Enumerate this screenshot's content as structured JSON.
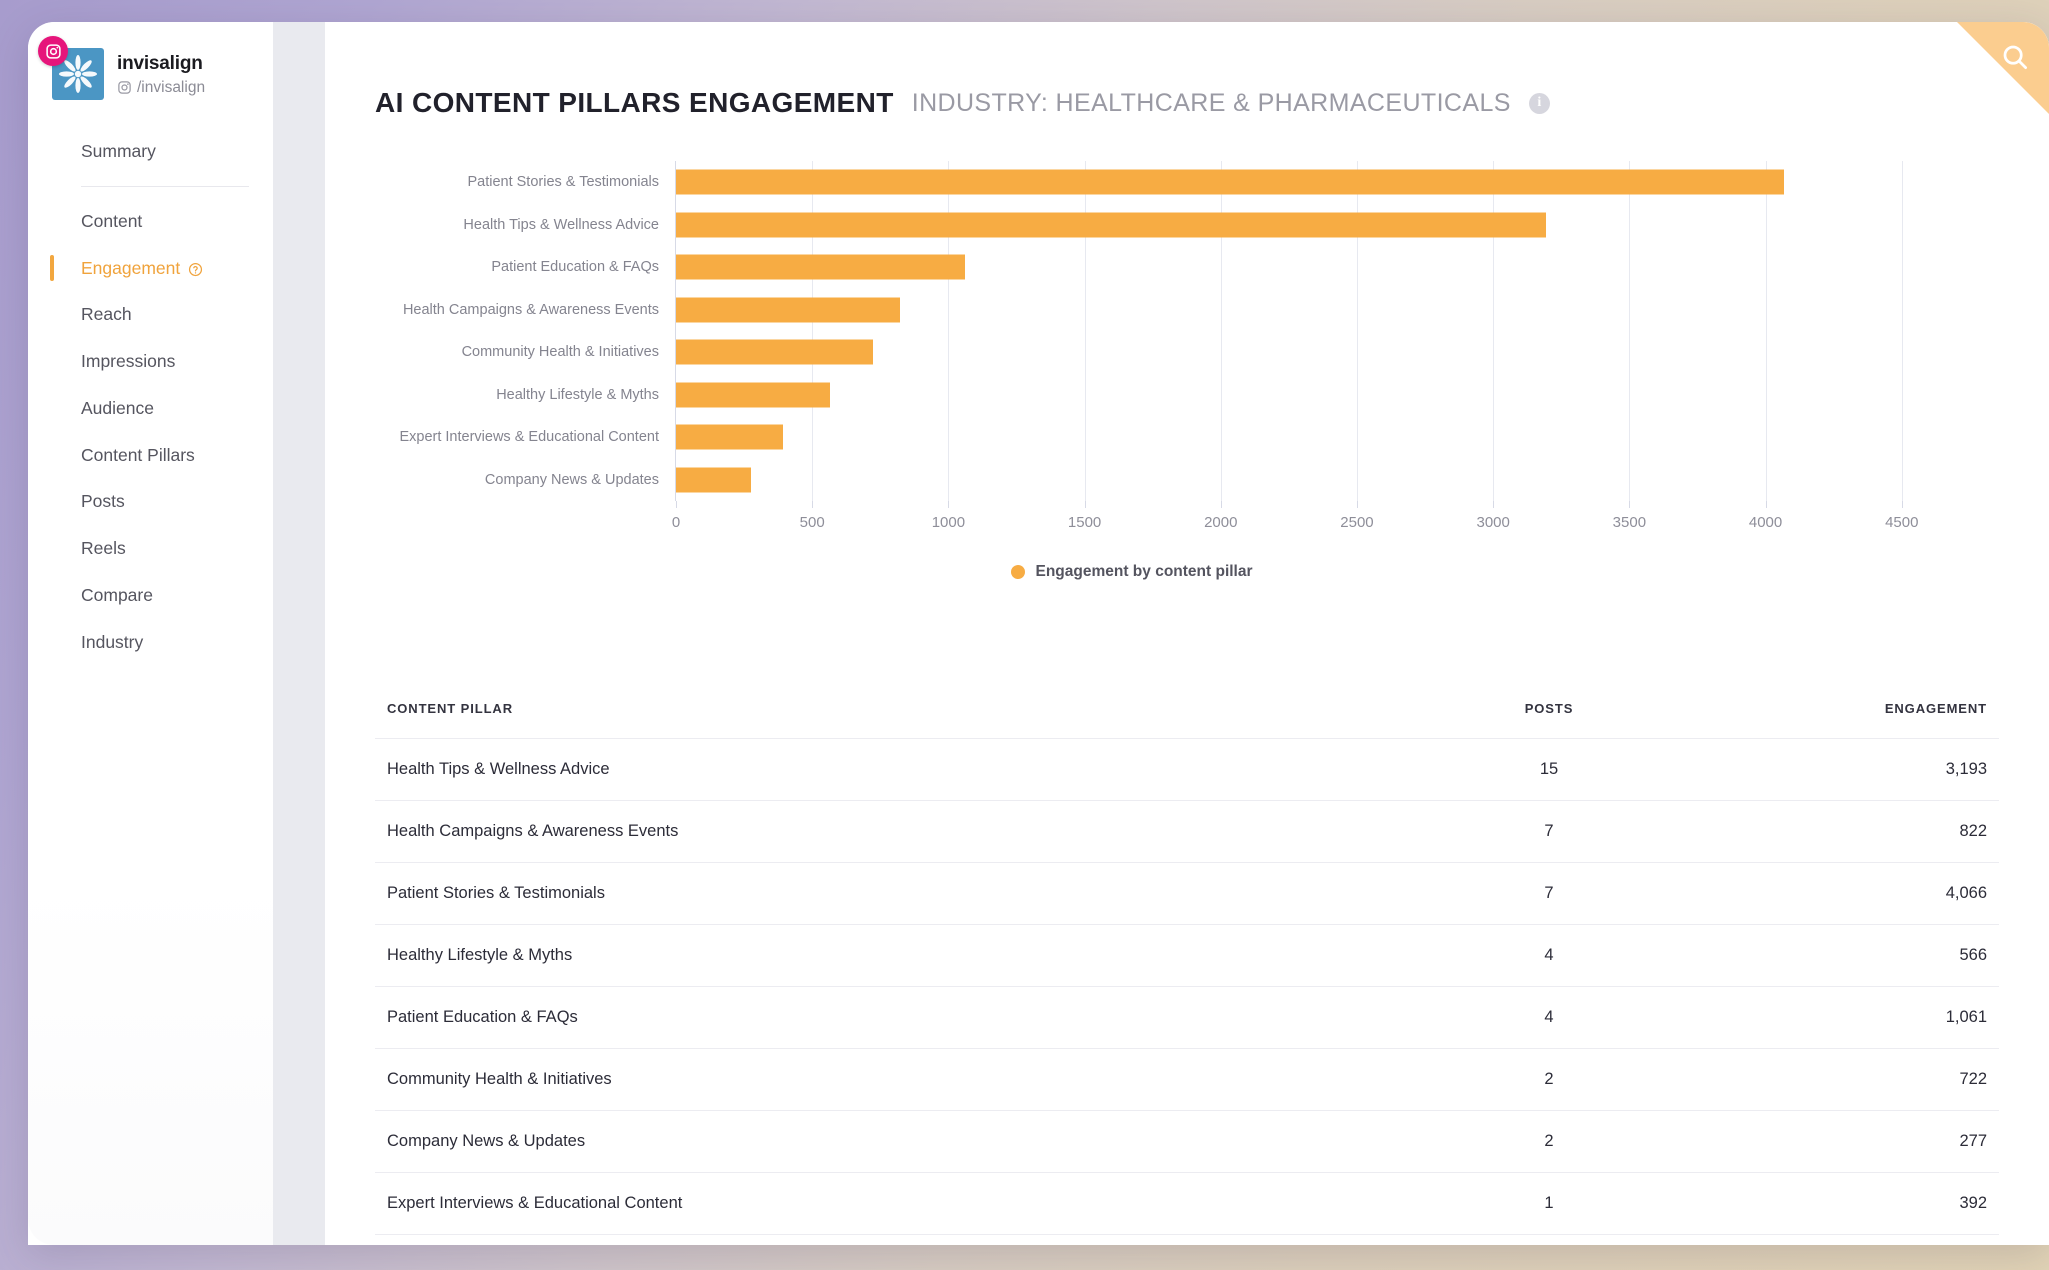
{
  "brand": {
    "name": "invisalign",
    "handle": "/invisalign",
    "platform_icon": "instagram-icon",
    "badge_color": "#e6157b",
    "avatar_color": "#4b96c4"
  },
  "sidebar": {
    "items": [
      {
        "label": "Summary",
        "active": false,
        "divider_after": true,
        "help": false
      },
      {
        "label": "Content",
        "active": false,
        "divider_after": false,
        "help": false
      },
      {
        "label": "Engagement",
        "active": true,
        "divider_after": false,
        "help": true
      },
      {
        "label": "Reach",
        "active": false,
        "divider_after": false,
        "help": false
      },
      {
        "label": "Impressions",
        "active": false,
        "divider_after": false,
        "help": false
      },
      {
        "label": "Audience",
        "active": false,
        "divider_after": false,
        "help": false
      },
      {
        "label": "Content Pillars",
        "active": false,
        "divider_after": false,
        "help": false
      },
      {
        "label": "Posts",
        "active": false,
        "divider_after": false,
        "help": false
      },
      {
        "label": "Reels",
        "active": false,
        "divider_after": false,
        "help": false
      },
      {
        "label": "Compare",
        "active": false,
        "divider_after": false,
        "help": false
      },
      {
        "label": "Industry",
        "active": false,
        "divider_after": false,
        "help": false
      }
    ],
    "active_color": "#f0a33c"
  },
  "header": {
    "title": "AI CONTENT PILLARS ENGAGEMENT",
    "subtitle": "INDUSTRY: HEALTHCARE & PHARMACEUTICALS",
    "info_icon": "info-icon",
    "info_glyph": "i"
  },
  "search": {
    "icon": "search-icon",
    "corner_color": "#fbcd8f"
  },
  "chart_data": {
    "type": "bar",
    "orientation": "horizontal",
    "title": "",
    "xlabel": "",
    "ylabel": "",
    "xlim": [
      0,
      4600
    ],
    "xticks": [
      0,
      500,
      1000,
      1500,
      2000,
      2500,
      3000,
      3500,
      4000,
      4500
    ],
    "xtick_labels": [
      "0",
      "500",
      "1000",
      "1500",
      "2000",
      "2500",
      "3000",
      "3500",
      "4000",
      "4500"
    ],
    "grid": true,
    "legend_position": "bottom",
    "legend": [
      "Engagement by content pillar"
    ],
    "series_color": "#f7ac43",
    "categories": [
      "Patient Stories & Testimonials",
      "Health Tips & Wellness Advice",
      "Patient Education & FAQs",
      "Health Campaigns & Awareness Events",
      "Community Health & Initiatives",
      "Healthy Lifestyle & Myths",
      "Expert Interviews & Educational Content",
      "Company News & Updates"
    ],
    "values": [
      4066,
      3193,
      1061,
      822,
      722,
      566,
      392,
      277
    ]
  },
  "table": {
    "columns": [
      "CONTENT PILLAR",
      "POSTS",
      "ENGAGEMENT"
    ],
    "rows": [
      {
        "pillar": "Health Tips & Wellness Advice",
        "posts": "15",
        "engagement": "3,193"
      },
      {
        "pillar": "Health Campaigns & Awareness Events",
        "posts": "7",
        "engagement": "822"
      },
      {
        "pillar": "Patient Stories & Testimonials",
        "posts": "7",
        "engagement": "4,066"
      },
      {
        "pillar": "Healthy Lifestyle & Myths",
        "posts": "4",
        "engagement": "566"
      },
      {
        "pillar": "Patient Education & FAQs",
        "posts": "4",
        "engagement": "1,061"
      },
      {
        "pillar": "Community Health & Initiatives",
        "posts": "2",
        "engagement": "722"
      },
      {
        "pillar": "Company News & Updates",
        "posts": "2",
        "engagement": "277"
      },
      {
        "pillar": "Expert Interviews & Educational Content",
        "posts": "1",
        "engagement": "392"
      }
    ]
  }
}
